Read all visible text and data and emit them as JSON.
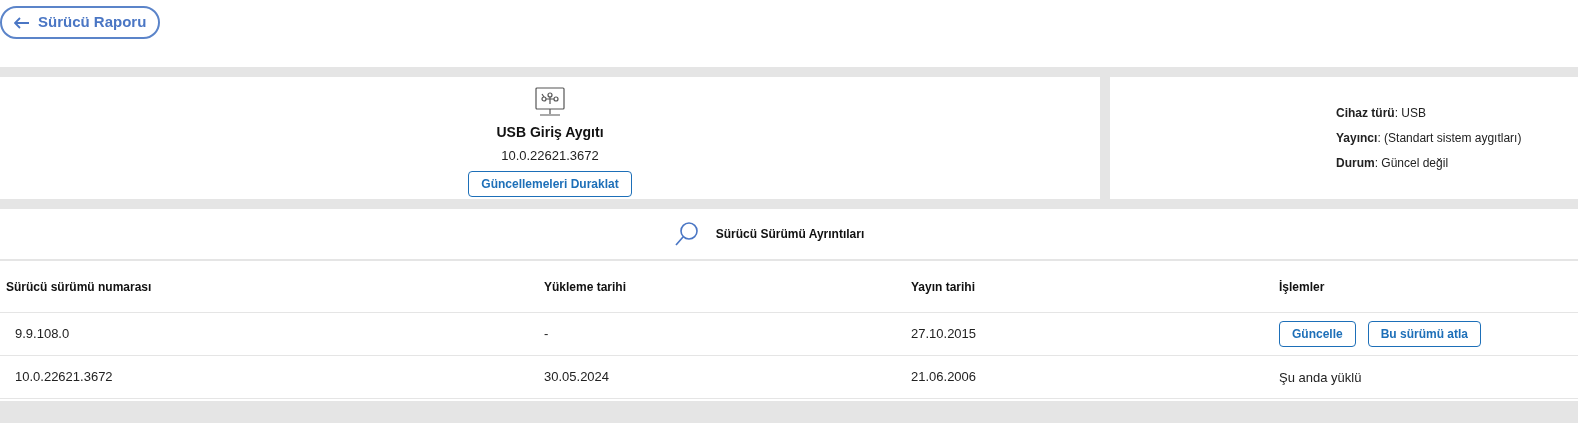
{
  "back_button": {
    "label": "Sürücü Raporu"
  },
  "device": {
    "name": "USB Giriş Aygıtı",
    "version": "10.0.22621.3672",
    "pause_button": "Güncellemeleri Duraklat"
  },
  "properties": [
    "**Cihaz türü**: USB",
    "**Yayıncı**: (Standart sistem aygıtları)",
    "**Durum**: Güncel değil"
  ],
  "details": {
    "title": "Sürücü Sürümü Ayrıntıları",
    "columns": [
      "Sürücü sürümü numarası",
      "Yükleme tarihi",
      "Yayın tarihi",
      "İşlemler"
    ],
    "rows": [
      {
        "version": "9.9.108.0",
        "install_date": "-",
        "release_date": "27.10.2015",
        "actions": {
          "kind": "buttons",
          "buttons": [
            "Güncelle",
            "Bu sürümü atla"
          ]
        }
      },
      {
        "version": "10.0.22621.3672",
        "install_date": "30.05.2024",
        "release_date": "21.06.2006",
        "actions": {
          "kind": "text",
          "text": "Şu anda yüklü"
        }
      }
    ]
  }
}
